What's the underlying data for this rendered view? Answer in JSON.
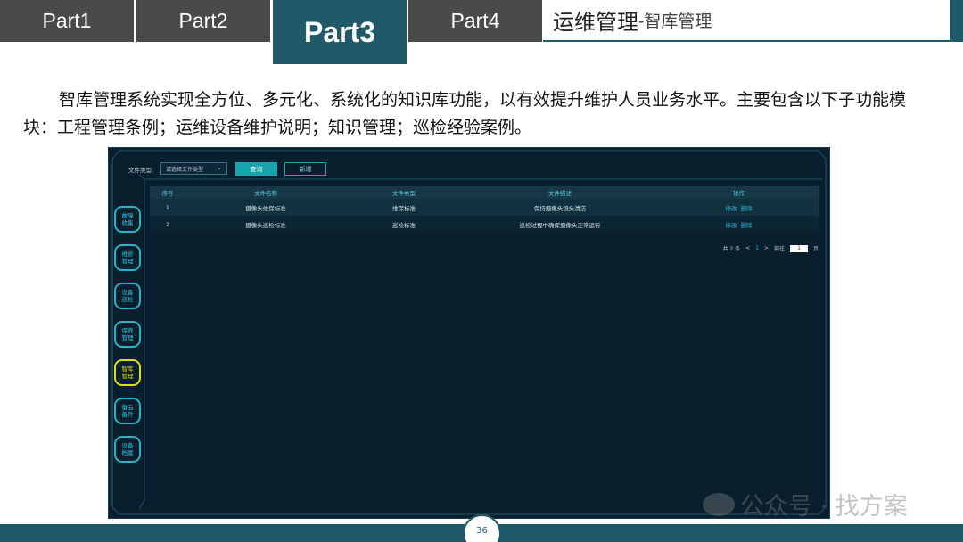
{
  "tabs": [
    {
      "label": "Part1",
      "active": false
    },
    {
      "label": "Part2",
      "active": false
    },
    {
      "label": "Part3",
      "active": true
    },
    {
      "label": "Part4",
      "active": false
    }
  ],
  "title": {
    "main": "运维管理",
    "sub": "-智库管理"
  },
  "paragraph": "智库管理系统实现全方位、多元化、系统化的知识库功能，以有效提升维护人员业务水平。主要包含以下子功能模块：工程管理条例；运维设备维护说明；知识管理；巡检经验案例。",
  "app": {
    "sidebar": [
      {
        "label": "故障收集",
        "active": false
      },
      {
        "label": "维修管理",
        "active": false
      },
      {
        "label": "设备巡检",
        "active": false
      },
      {
        "label": "保养管理",
        "active": false
      },
      {
        "label": "智库管理",
        "active": true
      },
      {
        "label": "备品备件",
        "active": false
      },
      {
        "label": "设备档案",
        "active": false
      }
    ],
    "filter": {
      "label": "文件类型:",
      "select_placeholder": "请选择文件类型",
      "query_label": "查询",
      "add_label": "新增"
    },
    "table": {
      "columns": [
        "序号",
        "文件名称",
        "文件类型",
        "文件描述",
        "操作"
      ],
      "rows": [
        {
          "index": "1",
          "name": "摄像头维保标准",
          "type": "维保标准",
          "desc": "保持摄像头镜头清洁",
          "edit": "修改",
          "delete": "删除"
        },
        {
          "index": "2",
          "name": "摄像头巡检标准",
          "type": "巡检标准",
          "desc": "巡检过程中确保摄像头正常运行",
          "edit": "修改",
          "delete": "删除"
        }
      ]
    },
    "pagination": {
      "total": "共 2 条",
      "prev": "<",
      "current": "1",
      "next": ">",
      "goto_label": "前往",
      "goto_value": "1",
      "page_suffix": "页"
    }
  },
  "footer": {
    "page_number": "36"
  },
  "watermark": "公众号 · 找方案"
}
